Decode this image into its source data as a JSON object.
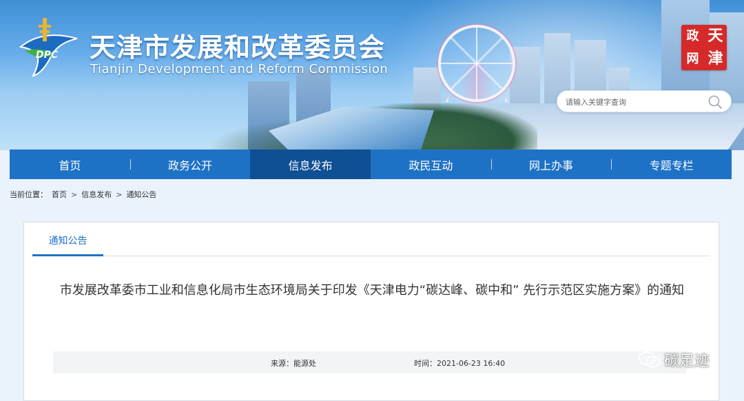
{
  "header": {
    "title": "天津市发展和改革委员会",
    "subtitle": "Tianjin Development and Reform Commission",
    "logo_text": "DPC",
    "badge_chars": [
      "天",
      "津",
      "政",
      "网"
    ],
    "search_placeholder": "请输入关键字查询",
    "search_icon": "search-icon"
  },
  "nav": {
    "items": [
      {
        "label": "首页",
        "active": false
      },
      {
        "label": "政务公开",
        "active": false
      },
      {
        "label": "信息发布",
        "active": true
      },
      {
        "label": "政民互动",
        "active": false
      },
      {
        "label": "网上办事",
        "active": false
      },
      {
        "label": "专题专栏",
        "active": false
      }
    ]
  },
  "breadcrumb": {
    "prefix": "当前位置：",
    "items": [
      "首页",
      "信息发布",
      "通知公告"
    ],
    "separator": ">"
  },
  "panel": {
    "tab_label": "通知公告",
    "article_title": "市发展改革委市工业和信息化局市生态环境局关于印发《天津电力“碳达峰、碳中和” 先行示范区实施方案》的通知",
    "source": "来源：能源处",
    "time": "时间：2021-06-23 16:40"
  },
  "watermark": {
    "text": "碳足迹",
    "icon": "wechat-icon"
  },
  "colors": {
    "nav_bg": "#1e72c6",
    "nav_active": "#0f4f93",
    "accent": "#1e72c6",
    "badge_red": "#d62a2a"
  }
}
